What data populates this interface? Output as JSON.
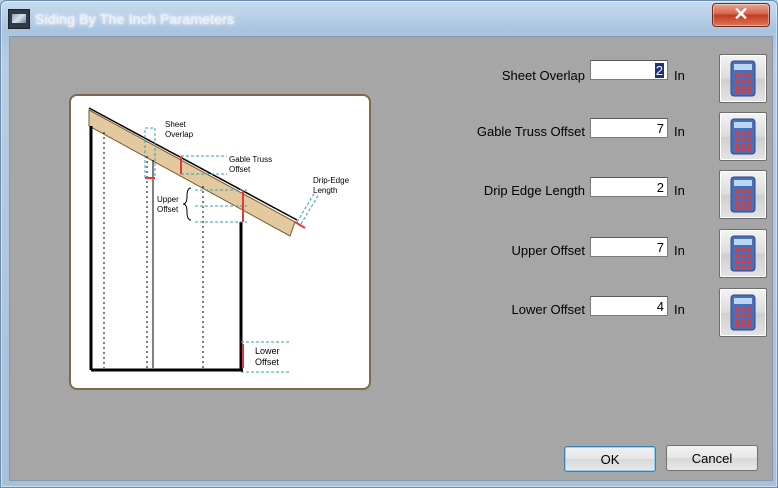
{
  "window": {
    "title": "Siding By The Inch Parameters",
    "close_symbol": "✕"
  },
  "diagram": {
    "labels": {
      "sheet_overlap": [
        "Sheet",
        "Overlap"
      ],
      "gable_truss_offset": [
        "Gable Truss",
        "Offset"
      ],
      "drip_edge_length": [
        "Drip-Edge",
        "Length"
      ],
      "upper_offset": [
        "Upper",
        "Offset"
      ],
      "lower_offset": [
        "Lower",
        "Offset"
      ]
    }
  },
  "fields": [
    {
      "label": "Sheet Overlap",
      "value": "2",
      "unit": "In",
      "selected": true
    },
    {
      "label": "Gable Truss Offset",
      "value": "7",
      "unit": "In"
    },
    {
      "label": "Drip Edge Length",
      "value": "2",
      "unit": "In"
    },
    {
      "label": "Upper Offset",
      "value": "7",
      "unit": "In"
    },
    {
      "label": "Lower Offset",
      "value": "4",
      "unit": "In"
    }
  ],
  "buttons": {
    "ok": "OK",
    "cancel": "Cancel"
  },
  "colors": {
    "accent_red": "#e53935",
    "guide_cyan": "#2fa3b8",
    "roof_wood": "#e3c9a0"
  }
}
